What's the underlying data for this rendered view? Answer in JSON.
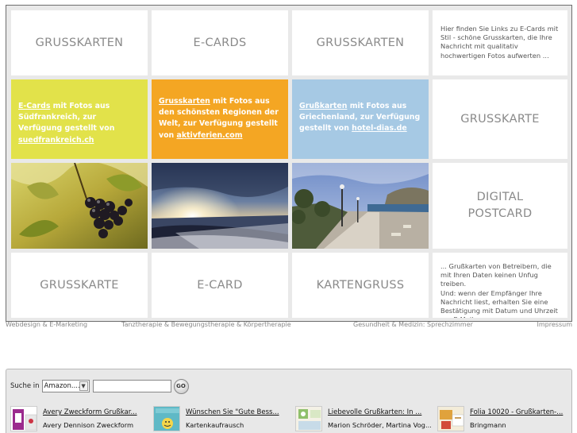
{
  "tiles": {
    "r1c1": "GRUSSKARTEN",
    "r1c2": "E-CARDS",
    "r1c3": "GRUSSKARTEN",
    "r1c4_text": "Hier finden Sie Links zu E-Cards mit Stil - schöne Grusskarten, die Ihre Nachricht mit qualitativ hochwertigen Fotos aufwerten ...",
    "r2c4": "GRUSSKARTE",
    "r3c4_line1": "DIGITAL",
    "r3c4_line2": "POSTCARD",
    "r4c1": "GRUSSKARTE",
    "r4c2": "E-CARD",
    "r4c3": "KARTENGRUSS",
    "r4c4_text1": "... Grußkarten von Betreibern, die mit Ihren Daten keinen Unfug treiben.",
    "r4c4_text2": "Und: wenn der Empfänger Ihre Nachricht liest, erhalten Sie eine Bestätigung mit Datum und Uhrzeit per E-Mail."
  },
  "promos": {
    "yellow": {
      "link": "E-Cards",
      "text": " mit Fotos aus Südfrankreich, zur Verfügung gestellt von ",
      "source": "suedfrankreich.ch",
      "color": "#e2e24a"
    },
    "orange": {
      "link": "Grusskarten",
      "text": " mit Fotos aus den schönsten Regionen der Welt, zur Verfügung gestellt von ",
      "source": "aktivferien.com",
      "color": "#f4a623"
    },
    "blue": {
      "link": "Grußkarten",
      "text": " mit Fotos aus Griechenland, zur Verfügung gestellt von ",
      "source": "hotel-dias.de",
      "color": "#a6c9e4"
    }
  },
  "footer": {
    "webdesign": "Webdesign & E-Marketing",
    "tanz": "Tanztherapie & Bewegungstherapie & Körpertherapie",
    "gesundheit": "Gesundheit & Medizin: Sprechzimmer",
    "impressum": "Impressum"
  },
  "shop": {
    "search_label": "Suche in",
    "select_value": "Amazon....",
    "go_label": "GO",
    "products": [
      {
        "title": "Avery Zweckform Grußkar...",
        "author": "Avery Dennison Zweckform"
      },
      {
        "title": "Wünschen Sie \"Gute Bess...",
        "author": "Kartenkaufrausch"
      },
      {
        "title": "Liebevolle Grußkarten: In ...",
        "author": "Marion Schröder, Martina Vog..."
      },
      {
        "title": "Folia 10020 - Grußkarten-...",
        "author": "Bringmann"
      }
    ]
  }
}
